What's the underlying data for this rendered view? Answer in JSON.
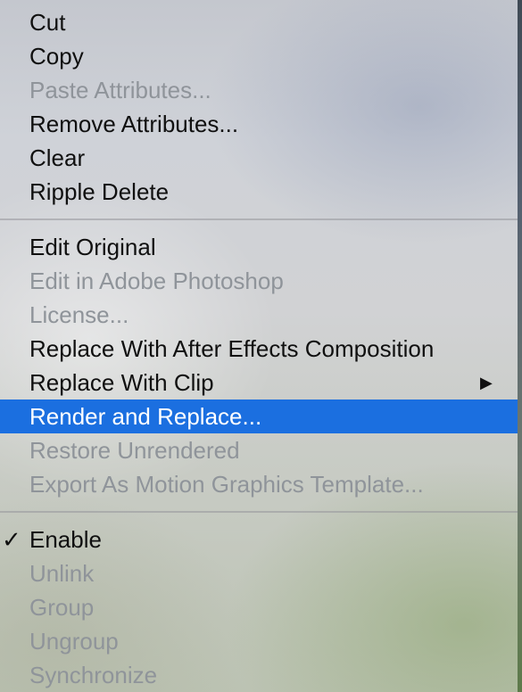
{
  "menu": {
    "section1": [
      {
        "label": "Cut",
        "enabled": true
      },
      {
        "label": "Copy",
        "enabled": true
      },
      {
        "label": "Paste Attributes...",
        "enabled": false
      },
      {
        "label": "Remove Attributes...",
        "enabled": true
      },
      {
        "label": "Clear",
        "enabled": true
      },
      {
        "label": "Ripple Delete",
        "enabled": true
      }
    ],
    "section2": [
      {
        "label": "Edit Original",
        "enabled": true
      },
      {
        "label": "Edit in Adobe Photoshop",
        "enabled": false
      },
      {
        "label": "License...",
        "enabled": false
      },
      {
        "label": "Replace With After Effects Composition",
        "enabled": true
      },
      {
        "label": "Replace With Clip",
        "enabled": true,
        "submenu": true,
        "arrow": "▶"
      },
      {
        "label": "Render and Replace...",
        "enabled": true,
        "highlighted": true
      },
      {
        "label": "Restore Unrendered",
        "enabled": false
      },
      {
        "label": "Export As Motion Graphics Template...",
        "enabled": false
      }
    ],
    "section3": [
      {
        "label": "Enable",
        "enabled": true,
        "checked": true,
        "checkmark": "✓"
      },
      {
        "label": "Unlink",
        "enabled": false
      },
      {
        "label": "Group",
        "enabled": false
      },
      {
        "label": "Ungroup",
        "enabled": false
      },
      {
        "label": "Synchronize",
        "enabled": false
      }
    ]
  },
  "colors": {
    "highlight": "#1b6fe0",
    "enabled_text": "#101010",
    "disabled_text": "#8f949a"
  }
}
